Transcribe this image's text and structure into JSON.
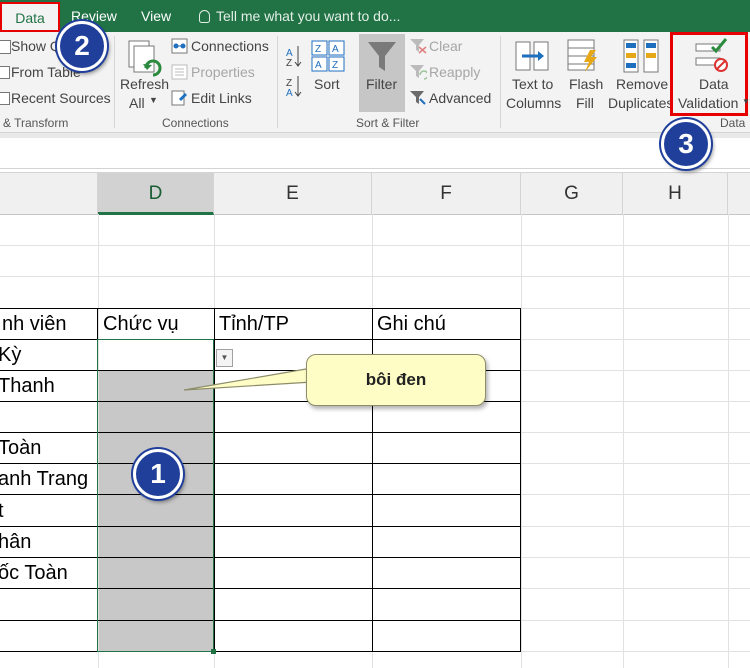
{
  "tabs": {
    "data": "Data",
    "review": "Review",
    "view": "View",
    "tell_me": "Tell me what you want to do..."
  },
  "ribbon": {
    "get_transform": {
      "show_queries": "Show Q",
      "from_table": "From Table",
      "recent_sources": "Recent Sources",
      "group_label": "& Transform"
    },
    "connections": {
      "refresh_all_line1": "Refresh",
      "refresh_all_line2": "All",
      "connections": "Connections",
      "properties": "Properties",
      "edit_links": "Edit Links",
      "group_label": "Connections"
    },
    "sort_filter": {
      "sort": "Sort",
      "filter": "Filter",
      "clear": "Clear",
      "reapply": "Reapply",
      "advanced": "Advanced",
      "group_label": "Sort & Filter"
    },
    "data_tools": {
      "text_to_columns_line1": "Text to",
      "text_to_columns_line2": "Columns",
      "flash_fill_line1": "Flash",
      "flash_fill_line2": "Fill",
      "remove_duplicates_line1": "Remove",
      "remove_duplicates_line2": "Duplicates",
      "data_validation_line1": "Data",
      "data_validation_line2": "Validation",
      "group_label": "Data"
    }
  },
  "columns": [
    "D",
    "E",
    "F",
    "G",
    "H"
  ],
  "sheet": {
    "headers": {
      "c": "nh viên",
      "d": "Chức vụ",
      "e": "Tỉnh/TP",
      "f": "Ghi chú"
    },
    "names": [
      "Kỳ",
      " Thanh",
      "",
      " Toàn",
      "anh Trang",
      "t",
      "hân",
      "ốc Toàn",
      "",
      ""
    ]
  },
  "callout_text": "bôi đen",
  "badges": {
    "one": "1",
    "two": "2",
    "three": "3"
  },
  "colors": {
    "excel_green": "#217346",
    "highlight_red": "#e60000",
    "badge_blue": "#1f3f9a",
    "callout_fill": "#fffdc6",
    "selection_gray": "#c8c8c8"
  }
}
